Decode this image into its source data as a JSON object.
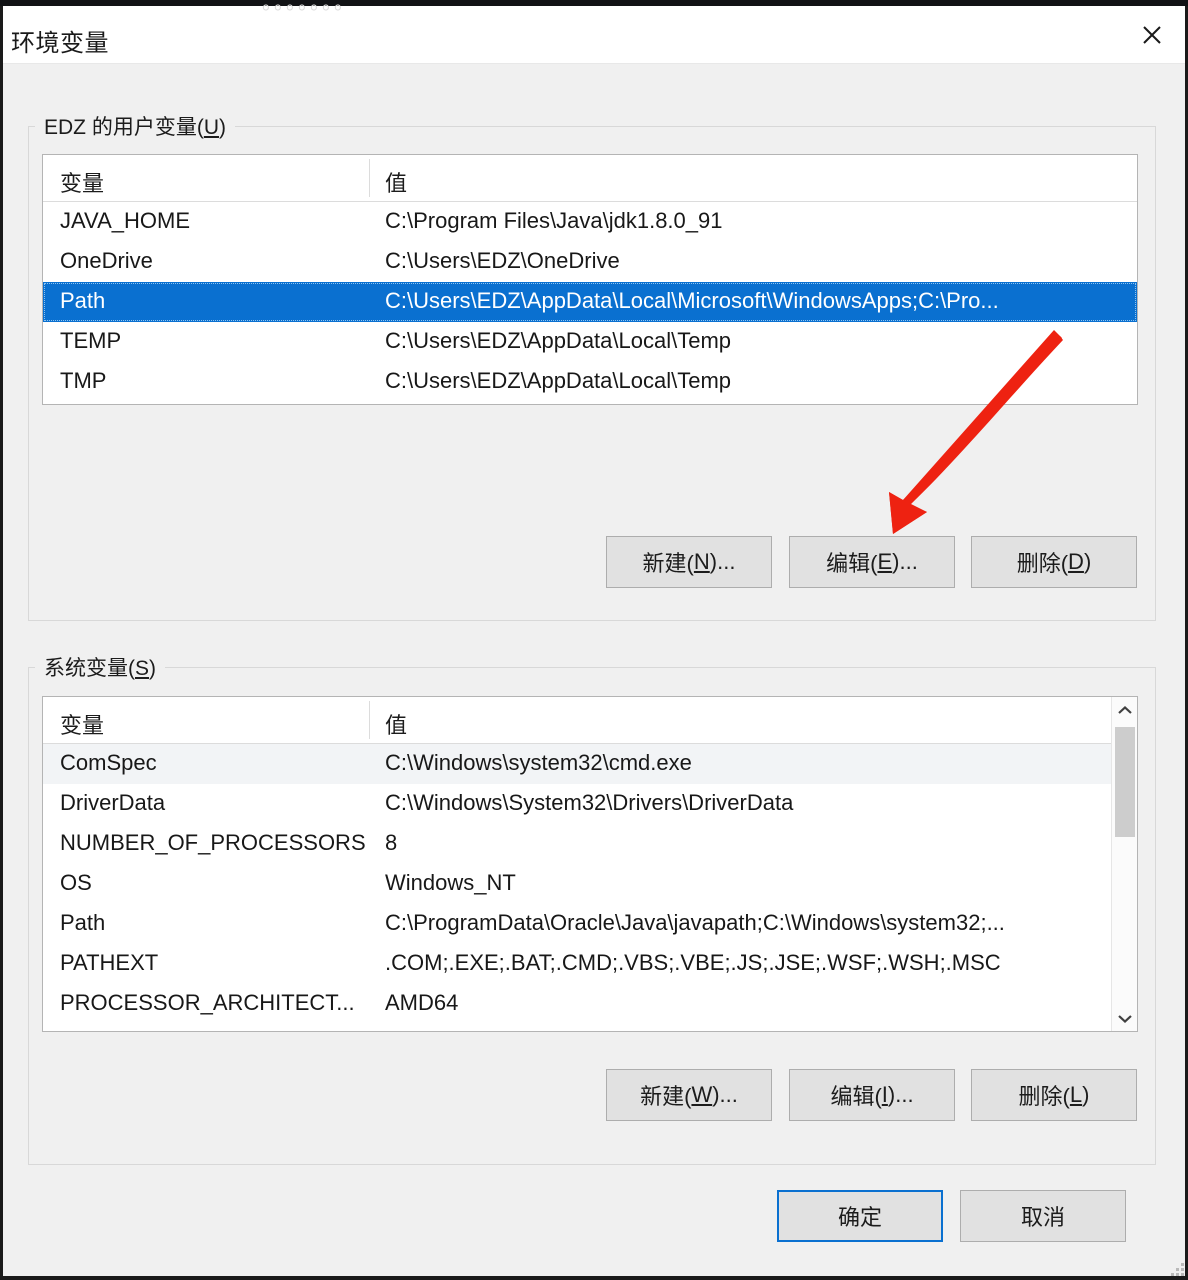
{
  "window": {
    "title": "环境变量",
    "close_icon": "close-icon",
    "cut_off_top_text": "。。。。。。。"
  },
  "user_section": {
    "label_prefix": "EDZ 的用户变量(",
    "label_mnemonic": "U",
    "label_suffix": ")",
    "columns": [
      "变量",
      "值"
    ],
    "rows": [
      {
        "name": "JAVA_HOME",
        "value": "C:\\Program Files\\Java\\jdk1.8.0_91",
        "selected": false
      },
      {
        "name": "OneDrive",
        "value": "C:\\Users\\EDZ\\OneDrive",
        "selected": false
      },
      {
        "name": "Path",
        "value": "C:\\Users\\EDZ\\AppData\\Local\\Microsoft\\WindowsApps;C:\\Pro...",
        "selected": true
      },
      {
        "name": "TEMP",
        "value": "C:\\Users\\EDZ\\AppData\\Local\\Temp",
        "selected": false
      },
      {
        "name": "TMP",
        "value": "C:\\Users\\EDZ\\AppData\\Local\\Temp",
        "selected": false
      }
    ],
    "buttons": {
      "new": {
        "prefix": "新建(",
        "mnemonic": "N",
        "suffix": ")..."
      },
      "edit": {
        "prefix": "编辑(",
        "mnemonic": "E",
        "suffix": ")..."
      },
      "delete": {
        "prefix": "删除(",
        "mnemonic": "D",
        "suffix": ")"
      }
    }
  },
  "system_section": {
    "label_prefix": "系统变量(",
    "label_mnemonic": "S",
    "label_suffix": ")",
    "columns": [
      "变量",
      "值"
    ],
    "rows": [
      {
        "name": "ComSpec",
        "value": "C:\\Windows\\system32\\cmd.exe",
        "hovered": true
      },
      {
        "name": "DriverData",
        "value": "C:\\Windows\\System32\\Drivers\\DriverData",
        "hovered": false
      },
      {
        "name": "NUMBER_OF_PROCESSORS",
        "value": "8",
        "hovered": false
      },
      {
        "name": "OS",
        "value": "Windows_NT",
        "hovered": false
      },
      {
        "name": "Path",
        "value": "C:\\ProgramData\\Oracle\\Java\\javapath;C:\\Windows\\system32;...",
        "hovered": false
      },
      {
        "name": "PATHEXT",
        "value": ".COM;.EXE;.BAT;.CMD;.VBS;.VBE;.JS;.JSE;.WSF;.WSH;.MSC",
        "hovered": false
      },
      {
        "name": "PROCESSOR_ARCHITECT...",
        "value": "AMD64",
        "hovered": false
      }
    ],
    "buttons": {
      "new": {
        "prefix": "新建(",
        "mnemonic": "W",
        "suffix": ")..."
      },
      "edit": {
        "prefix": "编辑(",
        "mnemonic": "I",
        "suffix": ")..."
      },
      "delete": {
        "prefix": "删除(",
        "mnemonic": "L",
        "suffix": ")"
      }
    },
    "scrollbar": {
      "up_icon": "chevron-up-icon",
      "down_icon": "chevron-down-icon"
    }
  },
  "footer": {
    "ok": "确定",
    "cancel": "取消"
  },
  "annotation": {
    "arrow_color": "#ee2211",
    "description": "red-arrow-pointing-to-edit-button"
  },
  "colors": {
    "selection_blue": "#0a70d0",
    "dialog_bg": "#f0f0f0",
    "button_bg": "#e1e1e1",
    "accent": "#0a70d0"
  }
}
